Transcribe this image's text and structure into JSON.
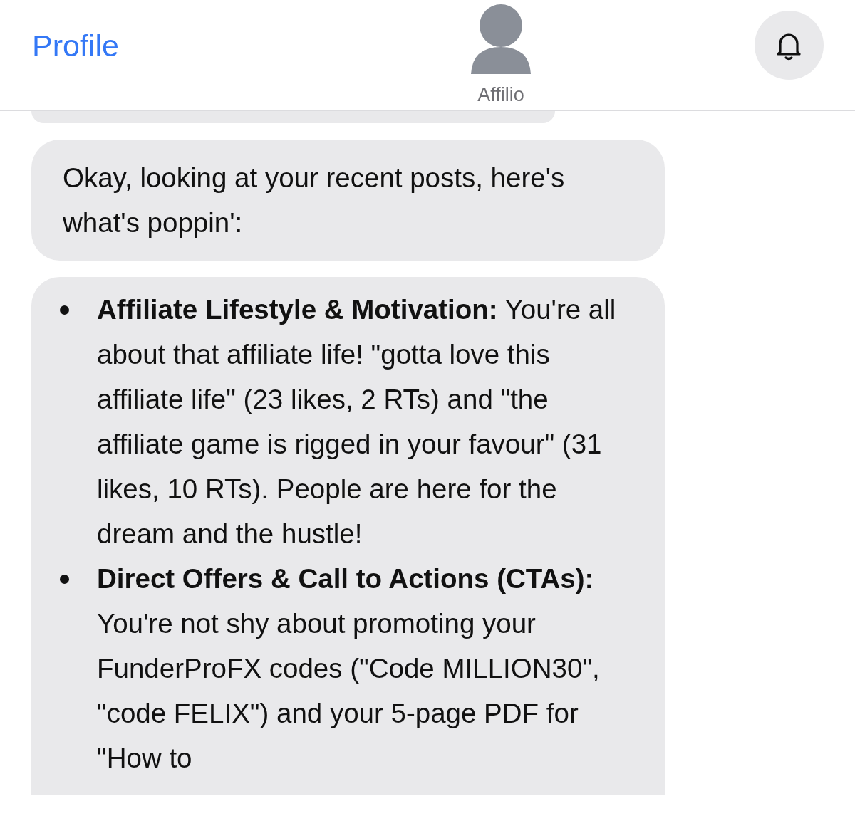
{
  "header": {
    "back_link": "Profile",
    "bot_name": "Affilio"
  },
  "messages": [
    {
      "kind": "partial"
    },
    {
      "kind": "text",
      "text": "Okay, looking at your recent posts, here's what's poppin':"
    },
    {
      "kind": "list",
      "items": [
        "**Affiliate Lifestyle & Motivation:** You're all about that affiliate life! \"gotta love this affiliate life\" (23 likes, 2 RTs) and \"the affiliate game is rigged in your favour\" (31 likes, 10 RTs). People are here for the dream and the hustle!",
        "**Direct Offers & Call to Actions (CTAs):** You're not shy about promoting your FunderProFX codes (\"Code MILLION30\", \"code FELIX\") and your 5-page PDF for \"How to"
      ]
    }
  ]
}
